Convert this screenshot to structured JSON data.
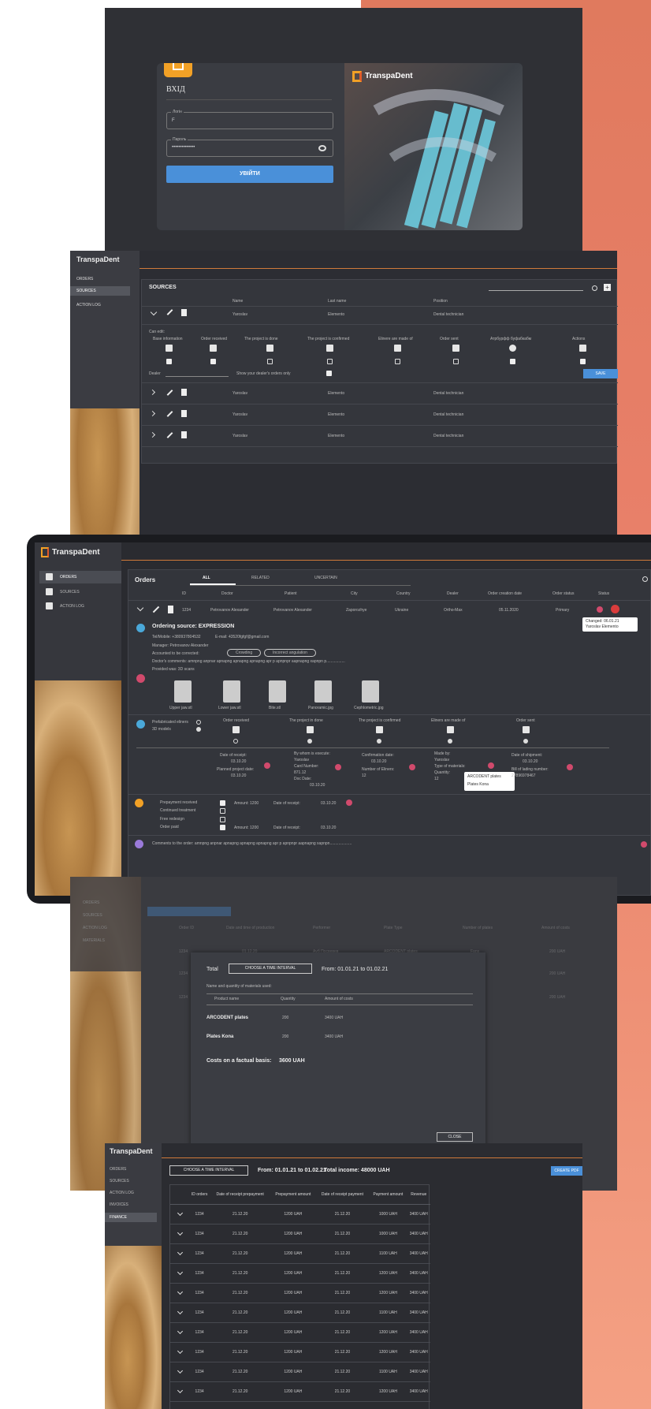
{
  "brand": "TranspaDent",
  "login": {
    "title": "ВХІД",
    "login_label": "Логін",
    "login_value": "F",
    "password_label": "Пароль",
    "password_value": "••••••••••••••",
    "submit": "УВІЙТИ"
  },
  "sources": {
    "menu": [
      "ORDERS",
      "SOURCES",
      "ACTION LOG"
    ],
    "title": "SOURCES",
    "headers": [
      "Name",
      "Last name",
      "Position"
    ],
    "first_row": {
      "name": "Yaroslav",
      "last": "Elemento",
      "pos": "Dental technician"
    },
    "can_edit": "Can edit:",
    "perm_labels": [
      "Base information",
      "Order received",
      "The project is done",
      "The project is confirmed",
      "Elinere are made of",
      "Order sent",
      "Атрбурфф буфабкабм",
      "Actions"
    ],
    "dealer_label": "Dealer",
    "show_dealer": "Show your dealer's orders only",
    "save": "SAVE",
    "rows": [
      {
        "name": "Yaroslav",
        "last": "Elemento",
        "pos": "Dental technician"
      },
      {
        "name": "Yaroslav",
        "last": "Elemento",
        "pos": "Dental technician"
      },
      {
        "name": "Yaroslav",
        "last": "Elemento",
        "pos": "Dental technician"
      }
    ]
  },
  "orders": {
    "menu": [
      "ORDERS",
      "SOURCES",
      "ACTION LOG"
    ],
    "title": "Orders",
    "tabs": [
      "ALL",
      "RELATED",
      "UNCERTAIN"
    ],
    "headers": [
      "ID",
      "Doctor",
      "Patient",
      "City",
      "Country",
      "Dealer",
      "Order creation date",
      "Order status",
      "Status"
    ],
    "row": {
      "id": "1234",
      "doctor": "Petrovanov Alexander",
      "patient": "Petrovanov Alexander",
      "city": "Zaporozhye",
      "country": "Ukraine",
      "dealer": "Ortho-Max",
      "date": "05.11.2020",
      "status": "Primary"
    },
    "tooltip1": "Changed: 06.01.21",
    "tooltip2": "Yaroslav Elemento",
    "ordering_source": "Ordering source: EXPRESSION",
    "tel": "Tel/Mobile: +380937804532",
    "email": "E-mail: 43520fgfgf@gmail.com",
    "manager": "Manager: Petrovanov Alexander",
    "accounted": "Accounted to be corrected:",
    "pill1": "Crowding",
    "pill2": "Incorrect angulation",
    "comments": "Doctor's comments: аmnpng anpnar apnapng apnapng apnapng apr p apnpnpr aapnapng xapnpn p.................",
    "provided": "Provided was: 3D scans",
    "files": [
      "Upper jaw.stl",
      "Lower jaw.stl",
      "Bite.stl",
      "Panoramic.jpg",
      "Cephlometric.jpg"
    ],
    "prefab": "Prefabricated eliners",
    "models": "3D models",
    "stages": [
      "Order received",
      "The project in done",
      "The project is confirmed",
      "Eliners are made of",
      "Order sent"
    ],
    "dr_date": "Date of receipt:",
    "dr_val": "03.10.20",
    "planned": "Planned project date:",
    "planned_val": "03.10.20",
    "by_whom": "By whom is execute:",
    "yaroslav": "Yaroslav",
    "card": "Card Number:",
    "card_val": "871.12",
    "doc_date": "Doc Date:",
    "doc_val": "03.10.20",
    "conf_date": "Confirmation date:",
    "conf_val": "03.10.20",
    "num_eliners": "Number of Eliners:",
    "num_val": "12",
    "made_by": "Made by:",
    "type_mat": "Type of materials:",
    "qty": "Quantity:",
    "qty_val": "12",
    "popup1": "ARCODENT plates",
    "popup2": "Plates Kona",
    "ship_date": "Date of shipment:",
    "ship_val": "03.10.20",
    "bill": "Bill of lading number:",
    "bill_val": "27896978467",
    "pay_items": [
      "Prepayment received",
      "Continued treatment",
      "Free redesign",
      "Order paid"
    ],
    "amount1": "Amount: 1200",
    "amount2": "Amount: 1200",
    "date_receipt": "Date of receipt:",
    "dr1": "03.10.20",
    "dr2": "03.10.20",
    "order_comments": "Comments to the order: аmnpng anpnar apnapng apnapng apnapng apr p apnpnpr aapnapng xapnpn...................."
  },
  "materials": {
    "menu": [
      "ORDERS",
      "SOURCES",
      "ACTION LOG",
      "MATERIALS"
    ],
    "total": "Total",
    "choose": "CHOOSE A TIME INTERVAL",
    "from": "From: 01.01.21 to 01.02.21",
    "subtitle": "Name and quantity of materials used:",
    "headers": [
      "Product name",
      "Quantity",
      "Amount of costs"
    ],
    "rows": [
      {
        "name": "ARCODENT plates",
        "qty": "200",
        "cost": "3400 UAH"
      },
      {
        "name": "Plates Kona",
        "qty": "200",
        "cost": "3400 UAH"
      }
    ],
    "costs": "Costs on a factual basis:",
    "costs_val": "3600 UAH",
    "close": "CLOSE",
    "bg_headers": [
      "Order ID",
      "Date and time of production",
      "Performer",
      "Plate Type",
      "Number of plates",
      "Amount of costs"
    ],
    "bg_rows": [
      {
        "id": "1234",
        "date": "01.12.20",
        "perf": "Ауб Посвевев",
        "type": "ARCODENT plates",
        "n": "Fans",
        "amt": "200 UAH"
      },
      {
        "id": "1234",
        "date": "",
        "perf": "",
        "type": "",
        "n": "",
        "amt": "200 UAH"
      },
      {
        "id": "1234",
        "date": "",
        "perf": "",
        "type": "",
        "n": "",
        "amt": "200 UAH"
      }
    ]
  },
  "finances": {
    "menu": [
      "ORDERS",
      "SOURCES",
      "ACTION LOG",
      "INVOICES",
      "FINANCE"
    ],
    "choose": "CHOOSE A TIME INTERVAL",
    "from": "From: 01.01.21 to 01.02.21",
    "total_income": "Total income: 48000 UAH",
    "create_btn": "CREATE PDF",
    "headers": [
      "ID orders",
      "Date of receipt prepayment",
      "Prepayment amount",
      "Date of receipt payment",
      "Payment amount",
      "Revenue"
    ],
    "rows": [
      [
        "1234",
        "21.12.20",
        "1200 UAH",
        "21.12.20",
        "1000 UAH",
        "3400 UAH"
      ],
      [
        "1234",
        "21.12.20",
        "1200 UAH",
        "21.12.20",
        "1000 UAH",
        "3400 UAH"
      ],
      [
        "1234",
        "21.12.20",
        "1200 UAH",
        "21.12.20",
        "1100 UAH",
        "3400 UAH"
      ],
      [
        "1234",
        "21.12.20",
        "1200 UAH",
        "21.12.20",
        "1200 UAH",
        "3400 UAH"
      ],
      [
        "1234",
        "21.12.20",
        "1200 UAH",
        "21.12.20",
        "1200 UAH",
        "3400 UAH"
      ],
      [
        "1234",
        "21.12.20",
        "1200 UAH",
        "21.12.20",
        "1100 UAH",
        "3400 UAH"
      ],
      [
        "1234",
        "21.12.20",
        "1200 UAH",
        "21.12.20",
        "1200 UAH",
        "3400 UAH"
      ],
      [
        "1234",
        "21.12.20",
        "1200 UAH",
        "21.12.20",
        "1200 UAH",
        "3400 UAH"
      ],
      [
        "1234",
        "21.12.20",
        "1200 UAH",
        "21.12.20",
        "1100 UAH",
        "3400 UAH"
      ],
      [
        "1234",
        "21.12.20",
        "1200 UAH",
        "21.12.20",
        "1200 UAH",
        "3400 UAH"
      ],
      [
        "1234",
        "21.12.20",
        "1200 UAH",
        "21.12.20",
        "1200 UAH",
        "3400 UAH"
      ]
    ]
  }
}
